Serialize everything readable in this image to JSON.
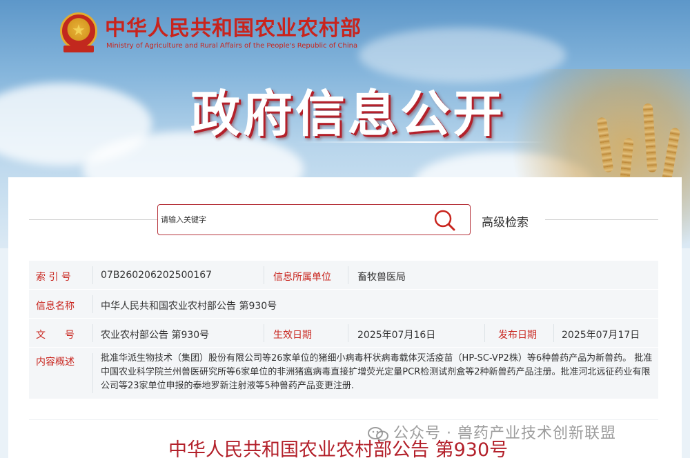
{
  "header": {
    "ministry_cn": "中华人民共和国农业农村部",
    "ministry_en": "Ministry of Agriculture and Rural Affairs of the People's Republic of China",
    "banner_title": "政府信息公开"
  },
  "search": {
    "placeholder": "请输入关键字",
    "advanced_label": "高级检索"
  },
  "info": {
    "index_label": "索 引 号",
    "index_value": "07B260206202500167",
    "org_label": "信息所属单位",
    "org_value": "畜牧兽医局",
    "name_label": "信息名称",
    "name_value": "中华人民共和国农业农村部公告 第930号",
    "doc_label": "文　　号",
    "doc_value": "农业农村部公告 第930号",
    "effective_label": "生效日期",
    "effective_value": "2025年07月16日",
    "publish_label": "发布日期",
    "publish_value": "2025年07月17日",
    "summary_label": "内容概述",
    "summary_value": "批准华派生物技术（集团）股份有限公司等26家单位的猪细小病毒杆状病毒载体灭活疫苗（HP-SC-VP2株）等6种兽药产品为新兽药。 批准中国农业科学院兰州兽医研究所等6家单位的非洲猪瘟病毒直接扩增荧光定量PCR检测试剂盒等2种新兽药产品注册。批准河北远征药业有限公司等23家单位申报的泰地罗新注射液等5种兽药产品变更注册."
  },
  "document": {
    "title": "中华人民共和国农业农村部公告 第930号"
  },
  "watermark": {
    "text": "公众号 · 兽药产业技术创新联盟"
  },
  "colors": {
    "accent_red": "#c8241d",
    "search_border": "#b6323a",
    "table_bg": "#f4f6f8"
  }
}
